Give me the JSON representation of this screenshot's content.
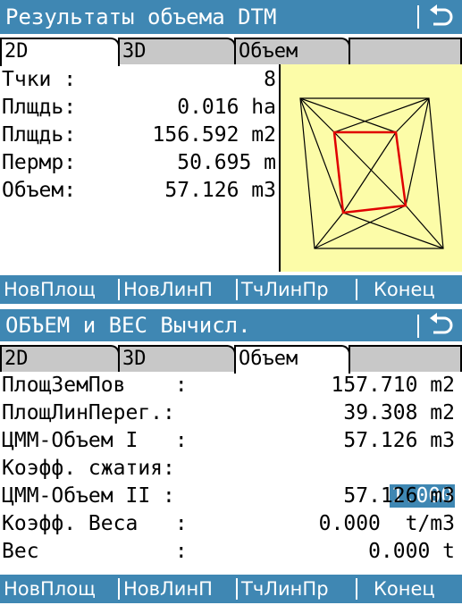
{
  "top": {
    "title": "Результаты объема DTM",
    "back_icon": "return-arrow-icon",
    "tabs": [
      "2D",
      "3D",
      "Объем"
    ],
    "active_tab": "2D",
    "rows": [
      {
        "label": "Тчки :",
        "value": "8"
      },
      {
        "label": "Плщдь:",
        "value": "0.016 ha"
      },
      {
        "label": "Плщдь:",
        "value": "156.592 m2"
      },
      {
        "label": "Пермр:",
        "value": "50.695 m"
      },
      {
        "label": "Объем:",
        "value": "57.126 m3"
      }
    ],
    "diagram_colors": {
      "background": "#fcfca8",
      "outline": "#000000",
      "boundary": "#e00000"
    },
    "footer": [
      "НовПлощ",
      "НовЛинП",
      "ТчЛинПр",
      "Конец"
    ]
  },
  "bottom": {
    "title": "ОБЪЕМ и ВЕС Вычисл.",
    "back_icon": "return-arrow-icon",
    "tabs": [
      "2D",
      "3D",
      "Объем"
    ],
    "active_tab": "Объем",
    "rows": [
      {
        "label": "ПлощЗемПов    :",
        "value": "157.710 m2"
      },
      {
        "label": "ПлощЛинПерег.:",
        "value": "39.308 m2"
      },
      {
        "label": "ЦММ-Объем I   :",
        "value": "57.126 m3"
      },
      {
        "label": "Коэфф. сжатия:",
        "value": "1.000"
      },
      {
        "label": "ЦММ-Объем II :",
        "value": "57.126 m3"
      },
      {
        "label": "Коэфф. Веса   :",
        "value": "0.000  t/m3"
      },
      {
        "label": "Вес           :",
        "value": "0.000 t"
      }
    ],
    "footer": [
      "НовПлощ",
      "НовЛинП",
      "ТчЛинПр",
      "Конец"
    ]
  },
  "colors": {
    "accent": "#3f87b3",
    "tab_inactive": "#c8c8c8"
  }
}
